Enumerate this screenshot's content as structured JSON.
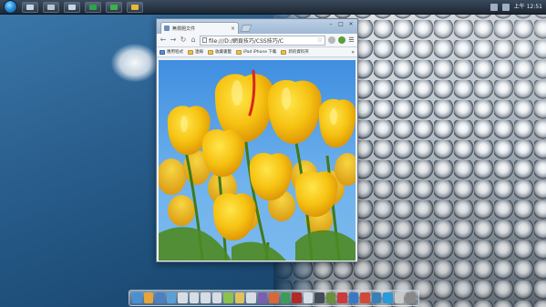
{
  "clock": "上午 12:51",
  "taskbar": {
    "buttons": [
      {
        "name": "taskbar-window-1",
        "color": "#c9d6e3"
      },
      {
        "name": "taskbar-window-2",
        "color": "#b8c7d6"
      },
      {
        "name": "taskbar-window-3",
        "color": "#c9d6e3"
      },
      {
        "name": "taskbar-window-4",
        "color": "#2fa24a"
      },
      {
        "name": "taskbar-window-5",
        "color": "#3bb34a"
      },
      {
        "name": "taskbar-window-6",
        "color": "#e8b63a"
      }
    ]
  },
  "browser": {
    "tab_title": "無標題文件",
    "tab_close": "×",
    "win_controls": [
      "–",
      "□",
      "×"
    ],
    "url": "file:///D:/網頁技巧/CSS技巧/C",
    "bookmarks": [
      {
        "label": "應用程式",
        "icon": "apps-icon"
      },
      {
        "label": "連線",
        "icon": "folder-icon"
      },
      {
        "label": "收藏書籤",
        "icon": "folder-icon"
      },
      {
        "label": "iPad iPhone 下載",
        "icon": "folder-icon"
      },
      {
        "label": "新的資料夾",
        "icon": "folder-icon"
      }
    ],
    "bookmarks_more": "»",
    "image": "yellow tulips against a blue sky"
  },
  "dock": {
    "items": [
      "#4a8fd3",
      "#e7a43a",
      "#4d7fc2",
      "#5aa0d8",
      "#d8dde3",
      "#d8dde3",
      "#d8dde3",
      "#d8dde3",
      "#8ec04e",
      "#e0c15a",
      "#d8dde3",
      "#7a5fb0",
      "#d9673a",
      "#3e9b5b",
      "#b02a2a",
      "#d8dde3",
      "#444c55",
      "#6a8f3e",
      "#cc3a3a",
      "#3a78c4",
      "#d04a3a",
      "#3a7fb8",
      "#2a9ad9",
      "#c9c9c9",
      "#888888"
    ]
  }
}
